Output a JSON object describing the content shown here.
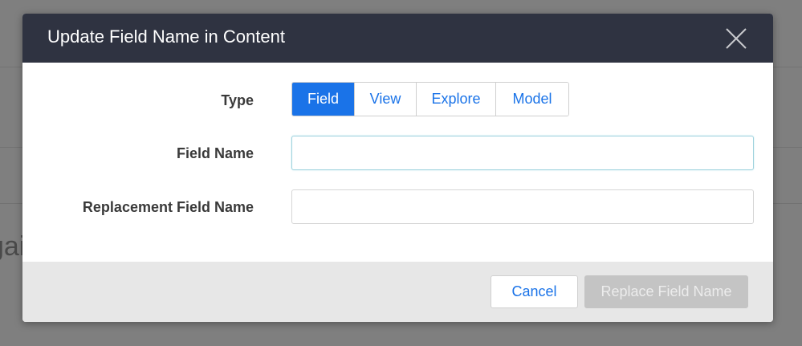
{
  "background": {
    "partial_text": "gai"
  },
  "modal": {
    "title": "Update Field Name in Content",
    "close_icon": "close-icon",
    "type_label": "Type",
    "type_options": [
      {
        "label": "Field",
        "selected": true
      },
      {
        "label": "View",
        "selected": false
      },
      {
        "label": "Explore",
        "selected": false
      },
      {
        "label": "Model",
        "selected": false
      }
    ],
    "field_name_label": "Field Name",
    "field_name_value": "",
    "replacement_label": "Replacement Field Name",
    "replacement_value": "",
    "cancel_label": "Cancel",
    "replace_label": "Replace Field Name"
  },
  "colors": {
    "header_bg": "#2f3341",
    "accent": "#1a73e8",
    "footer_bg": "#e7e7e7",
    "disabled_button": "#c4c4c4"
  }
}
